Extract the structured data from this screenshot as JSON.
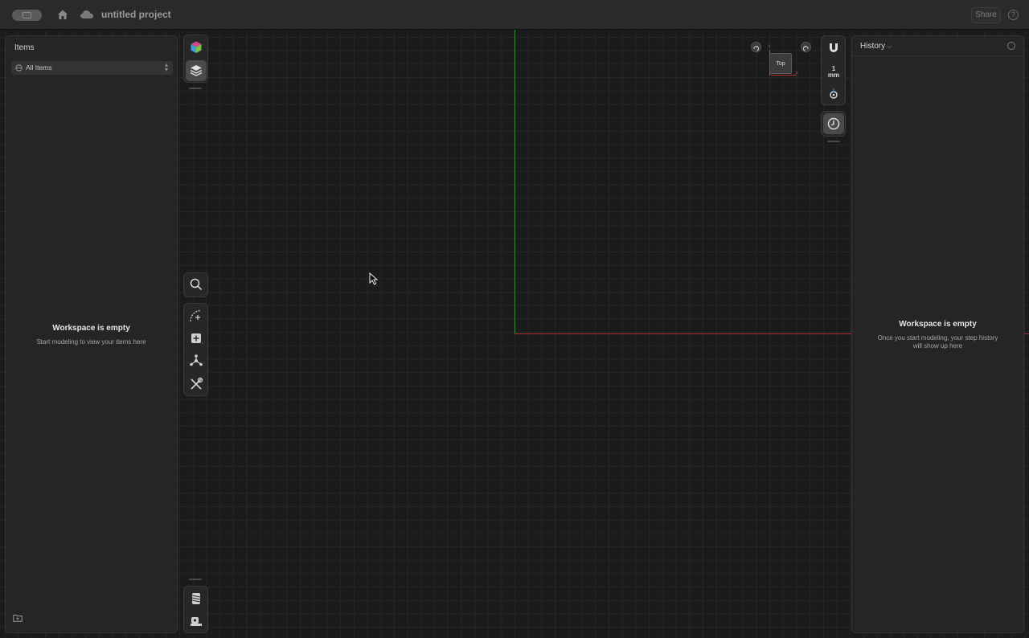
{
  "topbar": {
    "project_title": "untitled project",
    "share_label": "Share",
    "help_label": "?"
  },
  "left_panel": {
    "title": "Items",
    "filter_value": "All Items",
    "empty_title": "Workspace is empty",
    "empty_subtitle": "Start modeling to view your items here"
  },
  "viewport": {
    "view_label": "Top",
    "unit_value": "1",
    "unit_name": "mm",
    "axis_y_label": "Y",
    "axis_x_label": "X"
  },
  "right_panel": {
    "title": "History",
    "empty_title": "Workspace is empty",
    "empty_subtitle_line1": "Once you start modeling, your step history",
    "empty_subtitle_line2": "will show up here"
  },
  "colors": {
    "axis_x": "#a83030",
    "axis_y": "#3b8a3e",
    "panel_bg": "#252525",
    "canvas_bg": "#1b1b1b"
  }
}
